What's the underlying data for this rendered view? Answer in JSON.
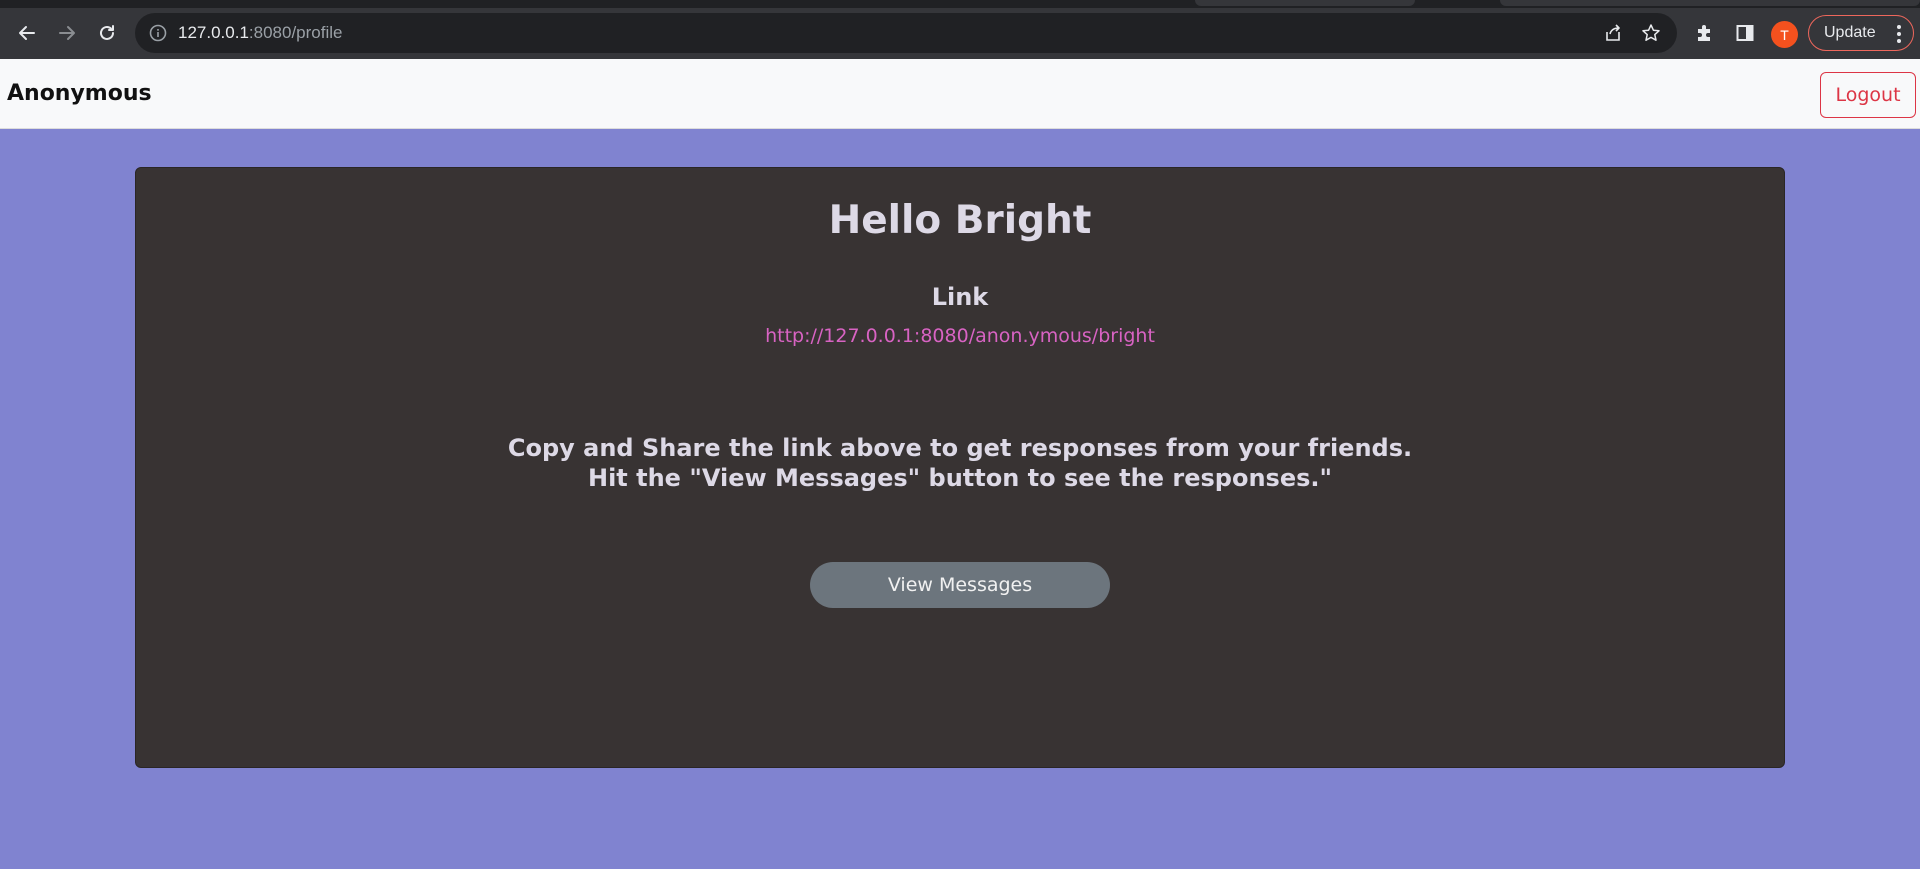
{
  "browser": {
    "url_host": "127.0.0.1",
    "url_rest": ":8080/profile",
    "avatar_letter": "T",
    "update_label": "Update"
  },
  "header": {
    "brand": "Anonymous",
    "logout_label": "Logout"
  },
  "card": {
    "greeting": "Hello Bright",
    "link_label": "Link",
    "share_link": "http://127.0.0.1:8080/anon.ymous/bright",
    "instructions": [
      "Copy and Share the link above to get responses from your friends.",
      "Hit the \"View Messages\" button to see the responses.\""
    ],
    "view_messages_label": "View Messages"
  },
  "colors": {
    "page_bg": "#8083d0",
    "card_bg": "#383333",
    "link": "#d863c3",
    "logout": "#dc3545",
    "button": "#6c757d"
  },
  "icons": [
    "back-icon",
    "forward-icon",
    "reload-icon",
    "info-icon",
    "share-icon",
    "star-icon",
    "extensions-icon",
    "side-panel-icon",
    "menu-dots-icon"
  ]
}
